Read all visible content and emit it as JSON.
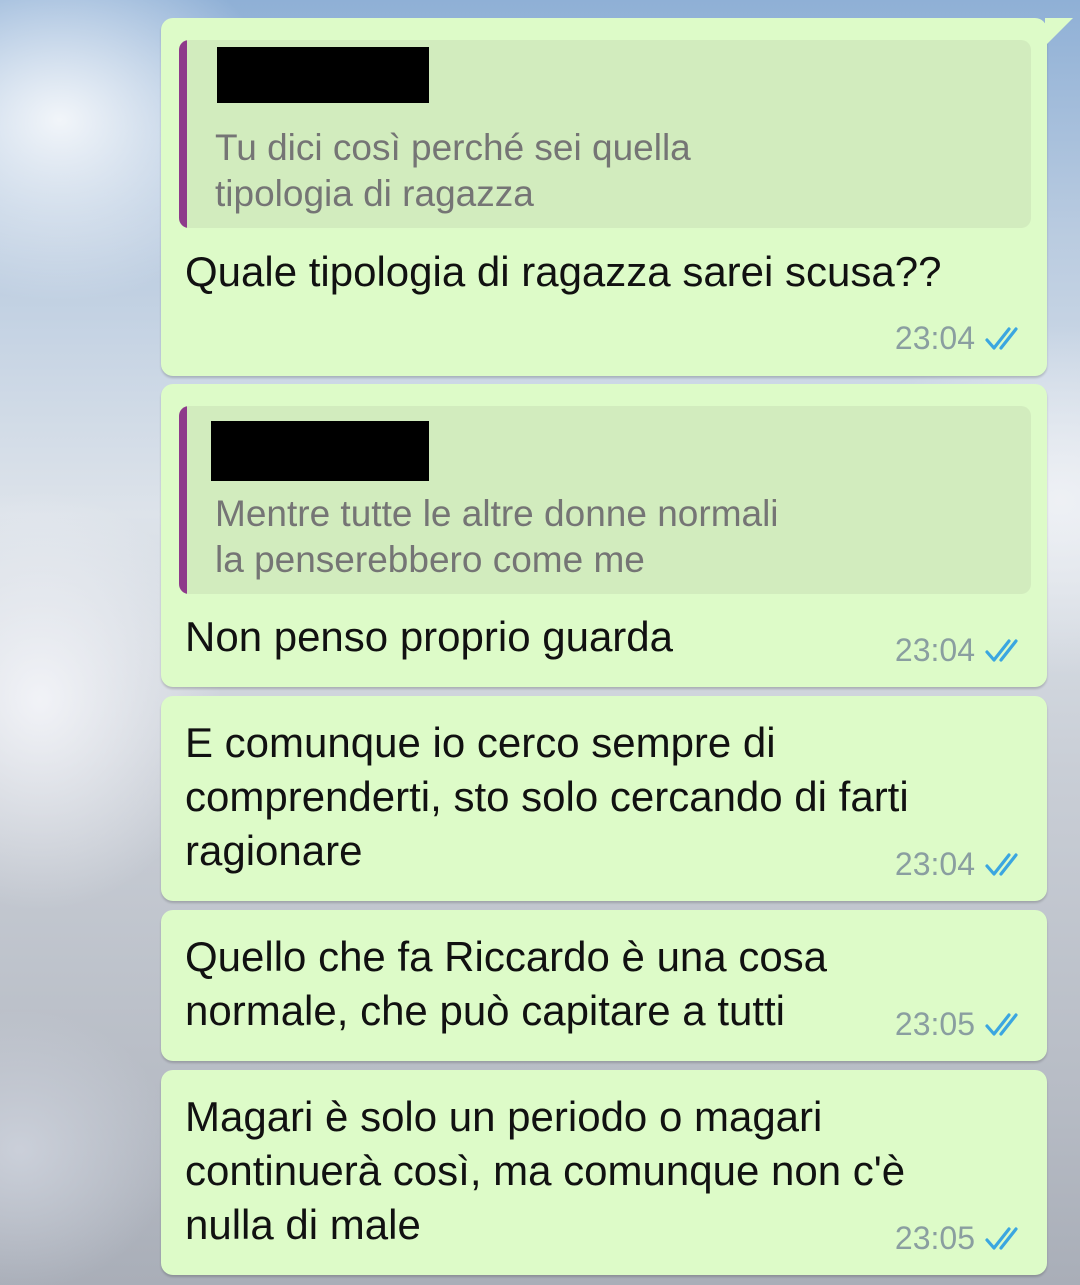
{
  "colors": {
    "bubble": "#ddfbc8",
    "quote_bg": "#d2ecbe",
    "quote_bar": "#8e3a8b",
    "read_ticks": "#3ba6e0"
  },
  "messages": [
    {
      "quote": {
        "author_redacted": true,
        "text": "Tu dici così perché sei quella\ntipologia di ragazza"
      },
      "text": "Quale tipologia di ragazza sarei scusa??",
      "time": "23:04",
      "status_icon": "double-check-read-icon"
    },
    {
      "quote": {
        "author_redacted": true,
        "text": "Mentre tutte le altre donne normali\nla penserebbero come me"
      },
      "text": "Non penso proprio guarda",
      "time": "23:04",
      "status_icon": "double-check-read-icon"
    },
    {
      "text": "E comunque io cerco sempre di\ncomprenderti, sto solo cercando di farti\nragionare",
      "time": "23:04",
      "status_icon": "double-check-read-icon"
    },
    {
      "text": "Quello che fa Riccardo è una cosa\nnormale, che può capitare a tutti",
      "time": "23:05",
      "status_icon": "double-check-read-icon"
    },
    {
      "text": "Magari è solo un periodo o magari\ncontinuerà così, ma comunque non c'è\nnulla di male",
      "time": "23:05",
      "status_icon": "double-check-read-icon"
    }
  ]
}
